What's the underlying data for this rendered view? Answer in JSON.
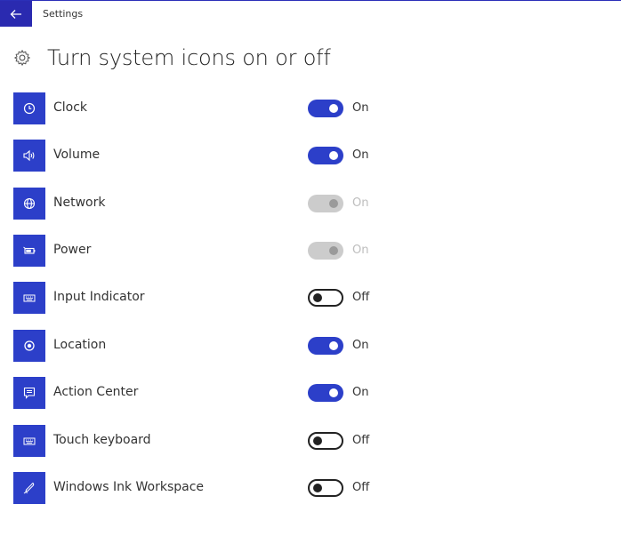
{
  "titlebar": {
    "app_title": "Settings"
  },
  "page": {
    "title": "Turn system icons on or off"
  },
  "colors": {
    "accent": "#2c3fc9",
    "disabled": "#cccccc"
  },
  "items": [
    {
      "label": "Clock",
      "icon": "clock-icon",
      "state": "On",
      "enabled": true
    },
    {
      "label": "Volume",
      "icon": "volume-icon",
      "state": "On",
      "enabled": true
    },
    {
      "label": "Network",
      "icon": "network-icon",
      "state": "On",
      "enabled": false
    },
    {
      "label": "Power",
      "icon": "power-icon",
      "state": "On",
      "enabled": false
    },
    {
      "label": "Input Indicator",
      "icon": "input-indicator-icon",
      "state": "Off",
      "enabled": true
    },
    {
      "label": "Location",
      "icon": "location-icon",
      "state": "On",
      "enabled": true
    },
    {
      "label": "Action Center",
      "icon": "action-center-icon",
      "state": "On",
      "enabled": true
    },
    {
      "label": "Touch keyboard",
      "icon": "keyboard-icon",
      "state": "Off",
      "enabled": true
    },
    {
      "label": "Windows Ink Workspace",
      "icon": "pen-icon",
      "state": "Off",
      "enabled": true
    }
  ]
}
